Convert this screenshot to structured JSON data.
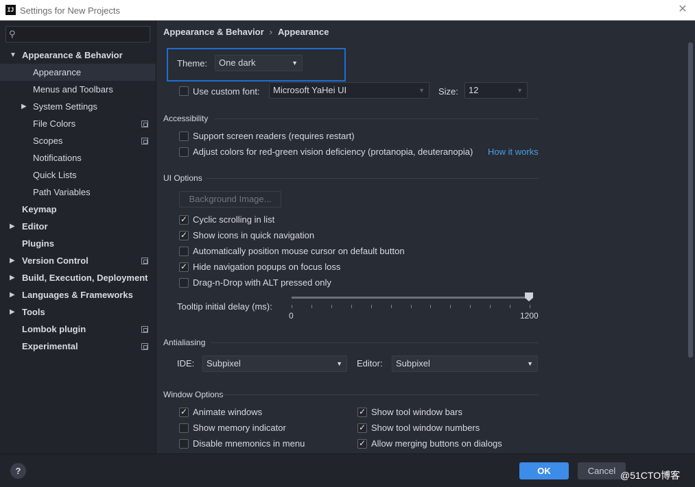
{
  "window": {
    "title": "Settings for New Projects",
    "logo_text": "IJ"
  },
  "search": {
    "placeholder": "",
    "icon": "search-icon"
  },
  "sidebar": {
    "items": [
      {
        "label": "Appearance & Behavior",
        "bold": true,
        "expanded": true
      },
      {
        "label": "Appearance",
        "selected": true
      },
      {
        "label": "Menus and Toolbars"
      },
      {
        "label": "System Settings",
        "collapsed": true
      },
      {
        "label": "File Colors",
        "project_icon": true
      },
      {
        "label": "Scopes",
        "project_icon": true
      },
      {
        "label": "Notifications"
      },
      {
        "label": "Quick Lists"
      },
      {
        "label": "Path Variables"
      },
      {
        "label": "Keymap",
        "bold": true
      },
      {
        "label": "Editor",
        "bold": true,
        "collapsed": true
      },
      {
        "label": "Plugins",
        "bold": true
      },
      {
        "label": "Version Control",
        "bold": true,
        "collapsed": true,
        "project_icon": true
      },
      {
        "label": "Build, Execution, Deployment",
        "bold": true,
        "collapsed": true
      },
      {
        "label": "Languages & Frameworks",
        "bold": true,
        "collapsed": true
      },
      {
        "label": "Tools",
        "bold": true,
        "collapsed": true
      },
      {
        "label": "Lombok plugin",
        "bold": true,
        "project_icon": true
      },
      {
        "label": "Experimental",
        "bold": true,
        "project_icon": true
      }
    ]
  },
  "breadcrumb": {
    "parent": "Appearance & Behavior",
    "separator": "›",
    "current": "Appearance"
  },
  "theme": {
    "label": "Theme:",
    "value": "One dark"
  },
  "custom_font": {
    "label": "Use custom font:",
    "checked": false,
    "font": "Microsoft YaHei UI",
    "size_label": "Size:",
    "size": "12"
  },
  "accessibility": {
    "title": "Accessibility",
    "screen_readers": {
      "label": "Support screen readers (requires restart)",
      "checked": false
    },
    "adjust_colors": {
      "label": "Adjust colors for red-green vision deficiency (protanopia, deuteranopia)",
      "checked": false
    },
    "how_it_works": "How it works"
  },
  "ui_options": {
    "title": "UI Options",
    "background_image": "Background Image...",
    "cyclic_scrolling": {
      "label": "Cyclic scrolling in list",
      "checked": true
    },
    "show_icons": {
      "label": "Show icons in quick navigation",
      "checked": true
    },
    "auto_position": {
      "label": "Automatically position mouse cursor on default button",
      "checked": false
    },
    "hide_popups": {
      "label": "Hide navigation popups on focus loss",
      "checked": true
    },
    "drag_drop": {
      "label": "Drag-n-Drop with ALT pressed only",
      "checked": false
    },
    "tooltip_delay": {
      "label": "Tooltip initial delay (ms):",
      "min": "0",
      "max": "1200",
      "value": 1200
    }
  },
  "antialiasing": {
    "title": "Antialiasing",
    "ide_label": "IDE:",
    "ide_value": "Subpixel",
    "editor_label": "Editor:",
    "editor_value": "Subpixel"
  },
  "window_options": {
    "title": "Window Options",
    "animate_windows": {
      "label": "Animate windows",
      "checked": true
    },
    "memory_indicator": {
      "label": "Show memory indicator",
      "checked": false
    },
    "disable_mnemonics": {
      "label": "Disable mnemonics in menu",
      "checked": false
    },
    "tool_window_bars": {
      "label": "Show tool window bars",
      "checked": true
    },
    "tool_window_numbers": {
      "label": "Show tool window numbers",
      "checked": true
    },
    "merging_buttons": {
      "label": "Allow merging buttons on dialogs",
      "checked": true
    }
  },
  "footer": {
    "help": "?",
    "ok": "OK",
    "cancel": "Cancel",
    "watermark": "@51CTO博客"
  },
  "colors": {
    "accent": "#3d8ce8",
    "highlight_border": "#1e6ed4",
    "link": "#4a9fe6",
    "background": "#282c34",
    "sidebar": "#21252b"
  }
}
